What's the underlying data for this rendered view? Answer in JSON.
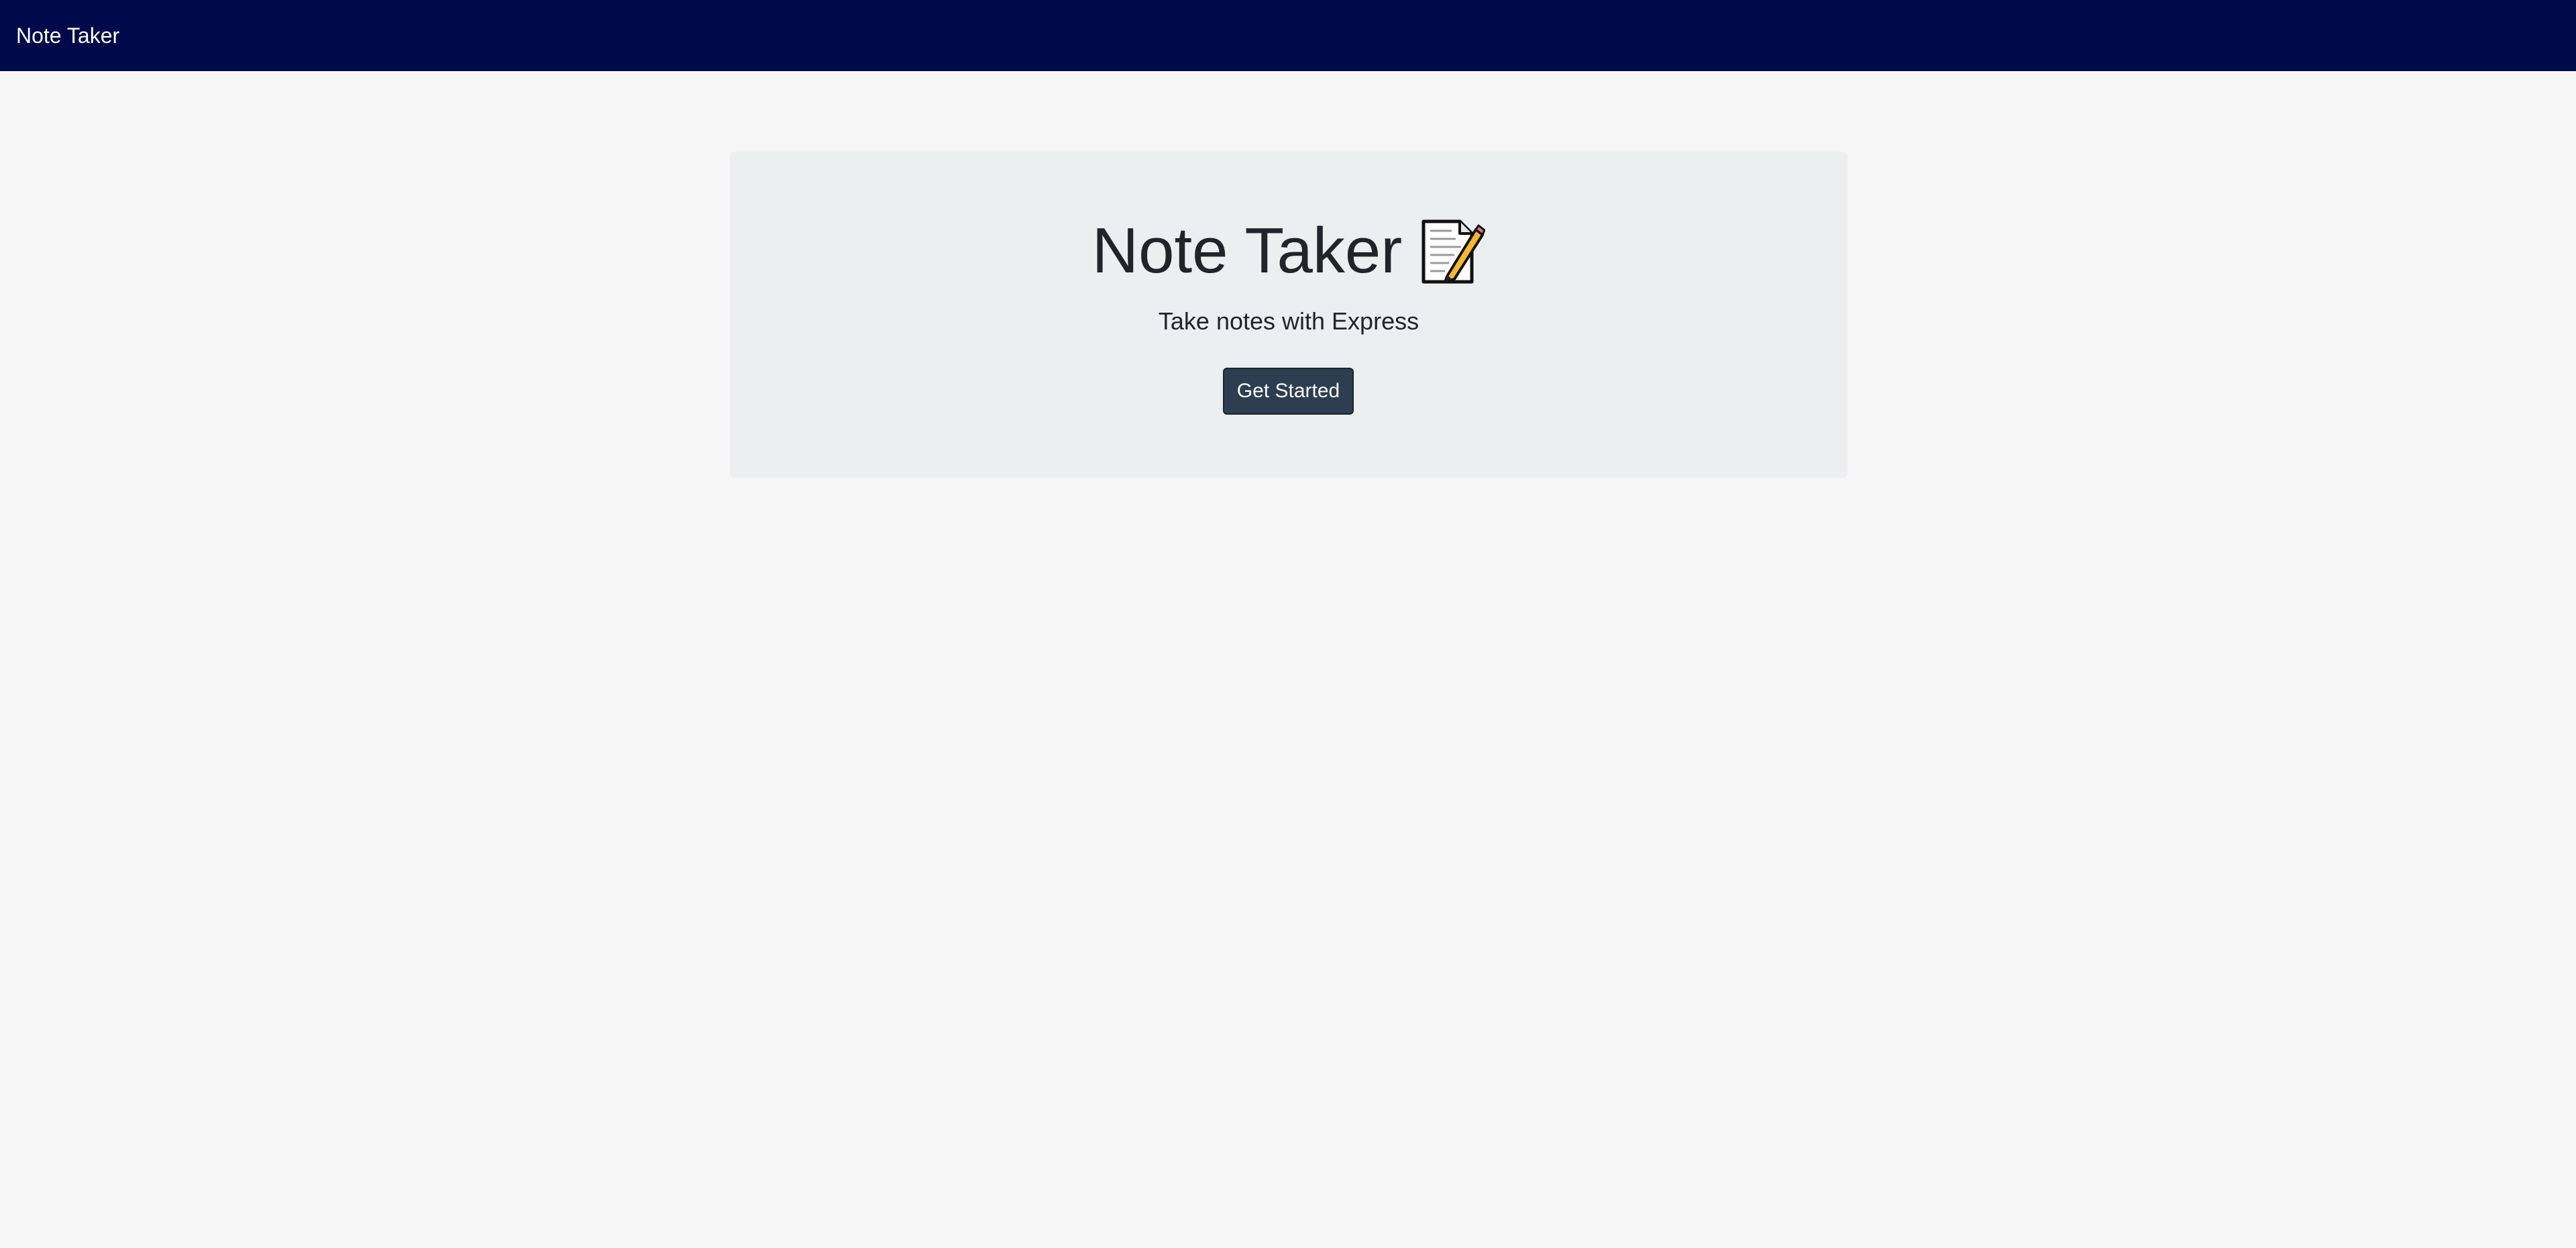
{
  "navbar": {
    "brand": "Note Taker",
    "background_color": "#000a4a"
  },
  "hero": {
    "title": "Note Taker",
    "title_icon": "memo-icon",
    "subtitle": "Take notes with Express",
    "button_label": "Get Started",
    "button_color": "#2c3e50"
  }
}
